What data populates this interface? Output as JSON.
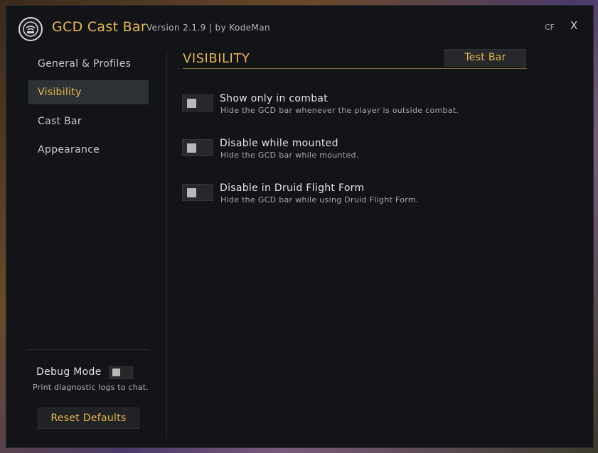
{
  "window": {
    "title": "GCD Cast Bar",
    "version": "Version 2.1.9  |  by KodeMan",
    "cf_label": "CF",
    "close_label": "X"
  },
  "sidebar": {
    "items": [
      {
        "label": "General & Profiles",
        "active": false
      },
      {
        "label": "Visibility",
        "active": true
      },
      {
        "label": "Cast Bar",
        "active": false
      },
      {
        "label": "Appearance",
        "active": false
      }
    ],
    "debug": {
      "label": "Debug Mode",
      "description": "Print diagnostic logs to chat.",
      "enabled": false
    },
    "reset_label": "Reset Defaults"
  },
  "main": {
    "section_title": "VISIBILITY",
    "test_button_label": "Test Bar",
    "options": [
      {
        "label": "Show only in combat",
        "description": "Hide the GCD bar whenever the player is outside combat.",
        "enabled": false
      },
      {
        "label": "Disable while mounted",
        "description": "Hide the GCD bar while mounted.",
        "enabled": false
      },
      {
        "label": "Disable in Druid Flight Form",
        "description": "Hide the GCD bar while using Druid Flight Form.",
        "enabled": false
      }
    ]
  },
  "colors": {
    "accent": "#e8b84a",
    "background": "#121418",
    "active_nav": "#2e3136"
  },
  "icons": {
    "logo": "gcd-logo-icon"
  }
}
